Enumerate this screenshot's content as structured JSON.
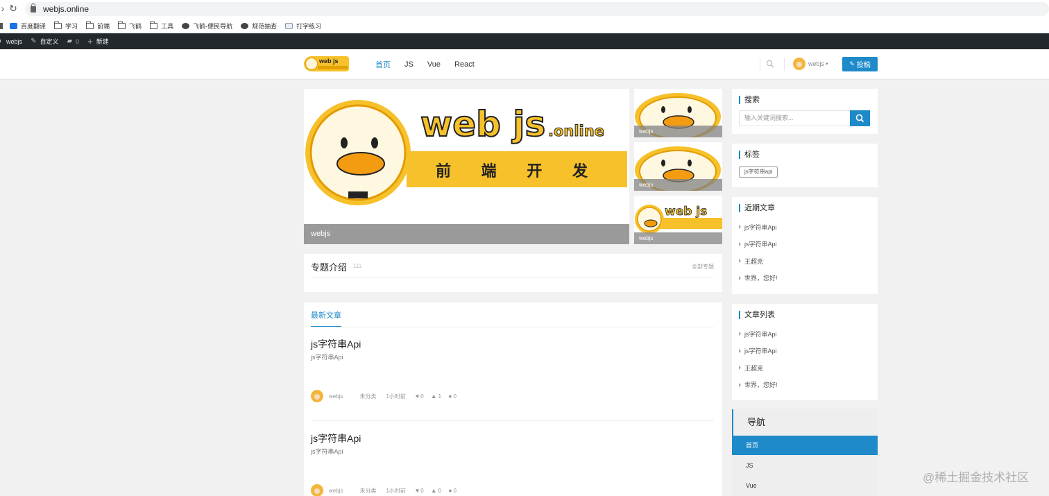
{
  "browser": {
    "url": "webjs.online"
  },
  "bookmarks": [
    {
      "label": "百度翻译",
      "icon": "translate-icon"
    },
    {
      "label": "学习",
      "icon": "folder-icon"
    },
    {
      "label": "前端",
      "icon": "folder-icon"
    },
    {
      "label": "飞鹤",
      "icon": "folder-icon"
    },
    {
      "label": "工具",
      "icon": "folder-icon"
    },
    {
      "label": "飞鹤-便民导航",
      "icon": "globe-icon"
    },
    {
      "label": "规范抽查",
      "icon": "globe-icon"
    },
    {
      "label": "打字练习",
      "icon": "typing-icon"
    }
  ],
  "adminbar": {
    "site": "webjs",
    "customize": "自定义",
    "comments": "0",
    "new": "新建"
  },
  "header": {
    "logo_text": "web js",
    "nav": [
      "首页",
      "JS",
      "Vue",
      "React"
    ],
    "user": "webjs",
    "post_button": "投稿"
  },
  "hero": {
    "caption": "webjs",
    "logo_text": "web js",
    "logo_suffix": ".online",
    "tagline": "前 端 开 发"
  },
  "thumbs": [
    {
      "caption": "webjs"
    },
    {
      "caption": "webjs"
    },
    {
      "caption": "webjs"
    }
  ],
  "topic": {
    "title": "专题介绍",
    "count": "111",
    "all": "全部专题"
  },
  "posts": {
    "tab": "最新文章",
    "items": [
      {
        "title": "js字符串Api",
        "excerpt": "js字符串Api",
        "author": "webjs",
        "category": "未分类",
        "time": "1小时前",
        "likes": "0",
        "thumbs": "1",
        "comments": "0"
      },
      {
        "title": "js字符串Api",
        "excerpt": "js字符串Api",
        "author": "webjs",
        "category": "未分类",
        "time": "1小时前",
        "likes": "0",
        "thumbs": "0",
        "comments": "0"
      }
    ]
  },
  "sidebar": {
    "search": {
      "title": "搜索",
      "placeholder": "输入关键词搜索..."
    },
    "tags": {
      "title": "标签",
      "items": [
        "js字符串api"
      ]
    },
    "recent": {
      "title": "近期文章",
      "items": [
        "js字符串Api",
        "js字符串Api",
        "王超克",
        "世界，您好!"
      ]
    },
    "list": {
      "title": "文章列表",
      "items": [
        "js字符串Api",
        "js字符串Api",
        "王超克",
        "世界，您好!"
      ]
    },
    "nav": {
      "title": "导航",
      "items": [
        "首页",
        "JS",
        "Vue"
      ]
    }
  },
  "watermark": "@稀土掘金技术社区",
  "colors": {
    "accent": "#1e8ac9",
    "adminbar": "#23282d",
    "logo_yellow": "#f6c12a"
  }
}
